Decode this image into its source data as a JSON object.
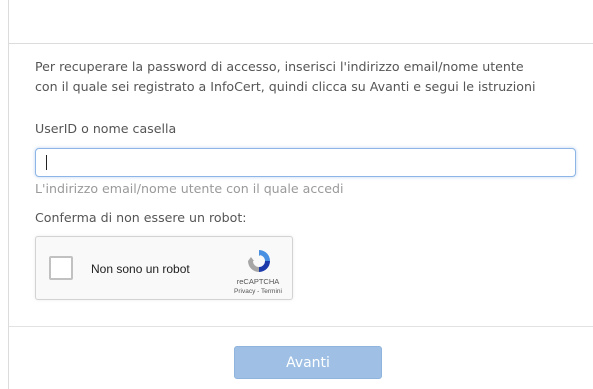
{
  "instructions": {
    "line1": "Per recuperare la password di accesso, inserisci l'indirizzo email/nome utente",
    "line2": "con il quale sei registrato a InfoCert, quindi clicca su Avanti e segui le istruzioni"
  },
  "userid_field": {
    "label": "UserID o nome casella",
    "value": "",
    "help_text": "L'indirizzo email/nome utente con il quale accedi"
  },
  "robot_check": {
    "label": "Conferma di non essere un robot:",
    "checkbox_text": "Non sono un robot",
    "checked": false,
    "brand": "reCAPTCHA",
    "privacy_link": "Privacy",
    "separator": " - ",
    "terms_link": "Termini"
  },
  "submit": {
    "label": "Avanti"
  },
  "colors": {
    "button_bg": "#9fc0e4",
    "input_focus_border": "#8db5e6",
    "text": "#555555",
    "help_text": "#9a9a9a"
  }
}
